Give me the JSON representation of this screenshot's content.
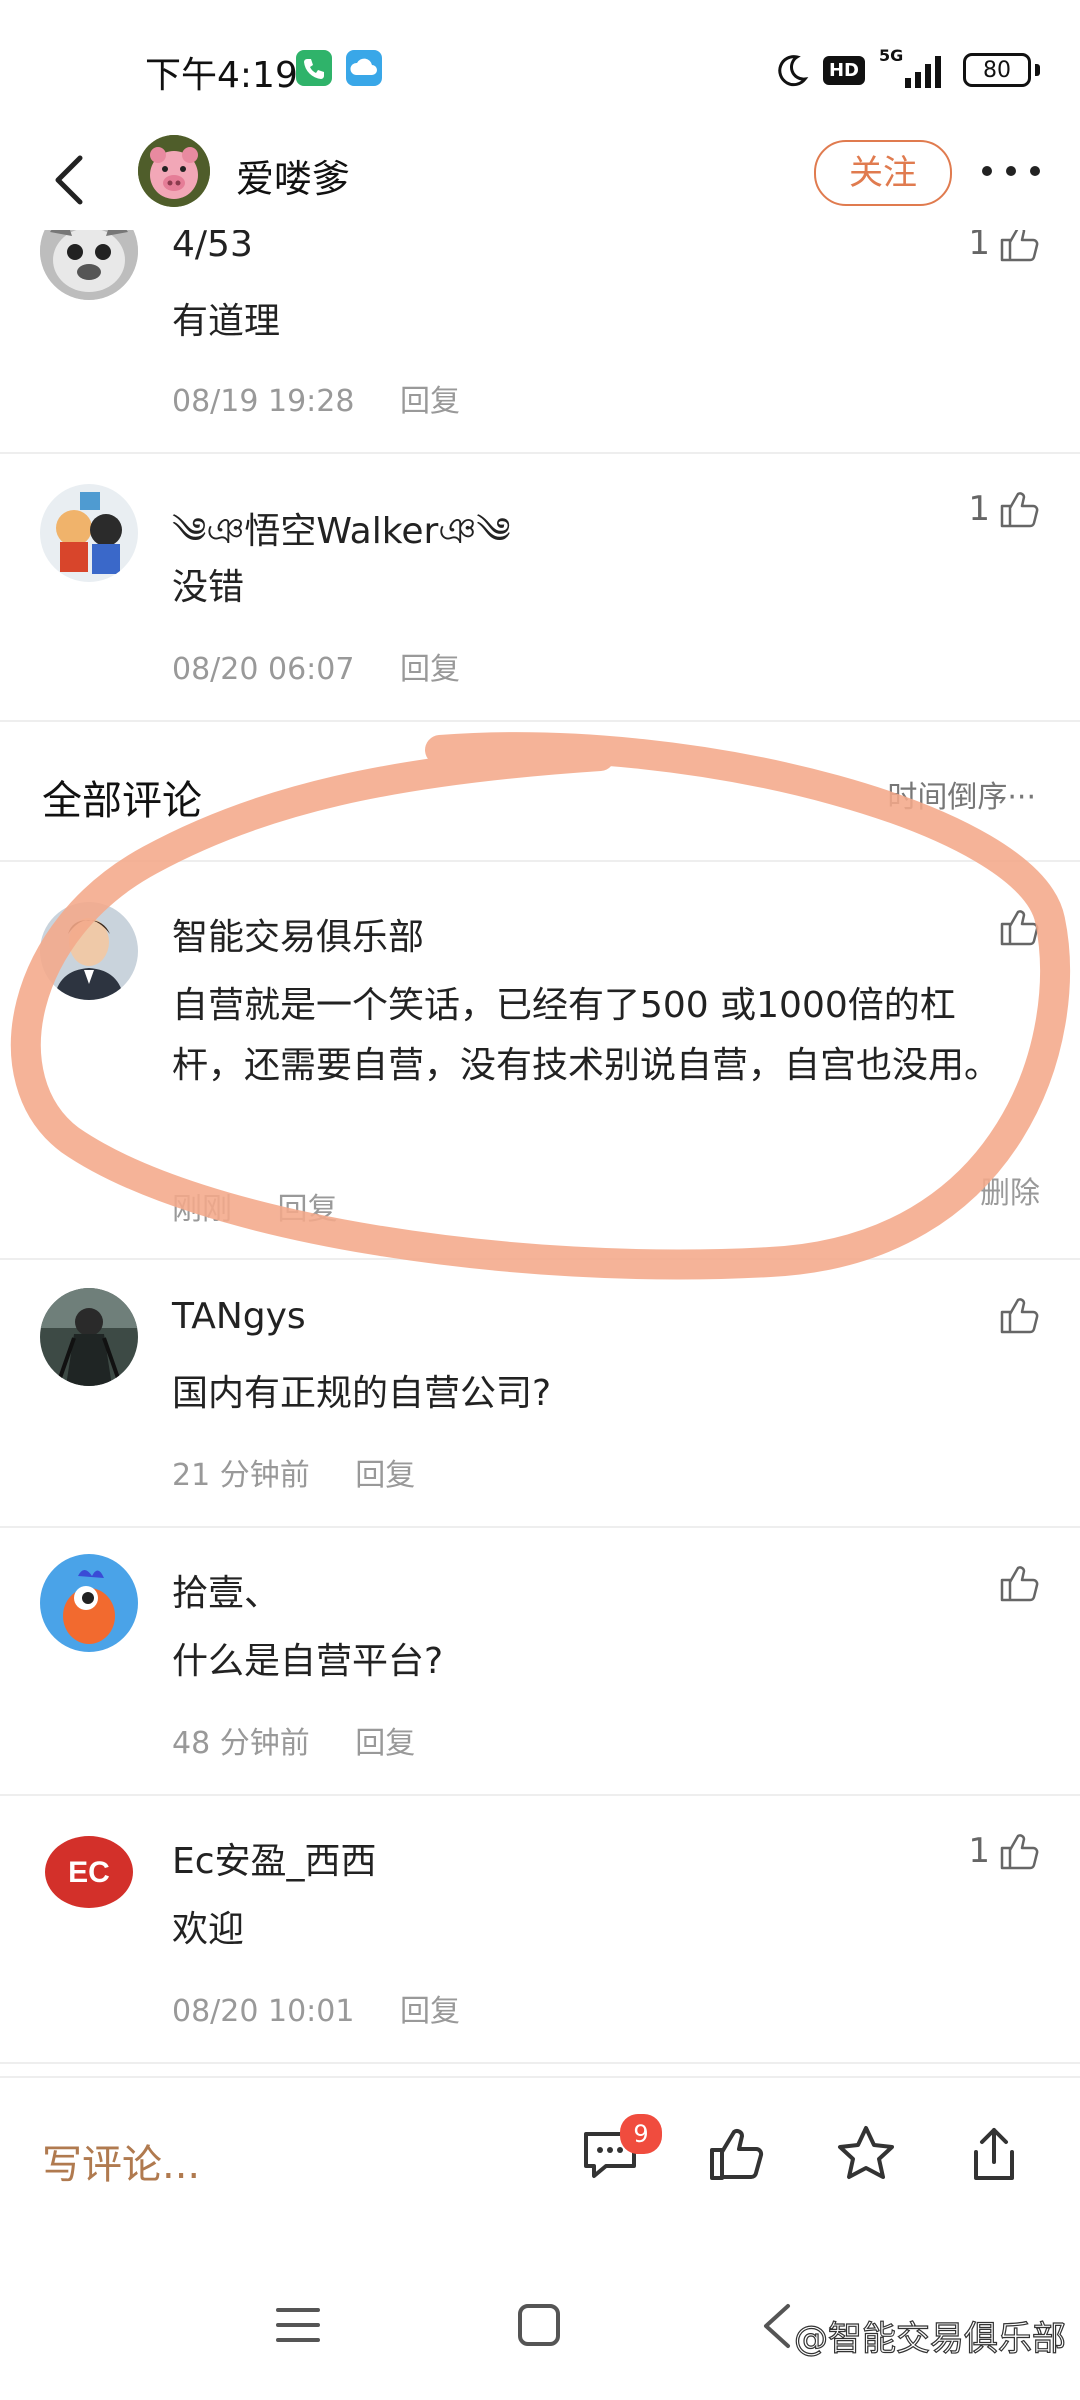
{
  "status_bar": {
    "time": "下午4:19",
    "hd": "HD",
    "network": "5G",
    "battery": "80"
  },
  "header": {
    "username": "爱喽爹",
    "follow_label": "关注"
  },
  "comments_top": [
    {
      "name": "4/53",
      "text": "有道理",
      "time": "08/19 19:28",
      "reply": "回复",
      "likes": "1"
    },
    {
      "name": "༄ঞ悟空Walkerঞ༄",
      "text": "没错",
      "time": "08/20 06:07",
      "reply": "回复",
      "likes": "1"
    }
  ],
  "section": {
    "title": "全部评论",
    "sort": "时间倒序···"
  },
  "comments": [
    {
      "name": "智能交易俱乐部",
      "text": "自营就是一个笑话，已经有了500 或1000倍的杠杆，还需要自营，没有技术别说自营，自宫也没用。",
      "time": "刚刚",
      "reply": "回复",
      "delete": "删除",
      "likes": ""
    },
    {
      "name": "TANgys",
      "text": "国内有正规的自营公司?",
      "time": "21 分钟前",
      "reply": "回复",
      "likes": ""
    },
    {
      "name": "拾壹、",
      "text": "什么是自营平台?",
      "time": "48 分钟前",
      "reply": "回复",
      "likes": ""
    },
    {
      "name": "Ec安盈_西西",
      "text": "欢迎",
      "time": "08/20 10:01",
      "reply": "回复",
      "likes": "1"
    }
  ],
  "bottom_bar": {
    "write_placeholder": "写评论...",
    "comment_count": "9"
  },
  "watermark": "@智能交易俱乐部",
  "colors": {
    "accent": "#e07b4f",
    "highlight": "#f4a98a",
    "badge": "#f04c3e"
  }
}
